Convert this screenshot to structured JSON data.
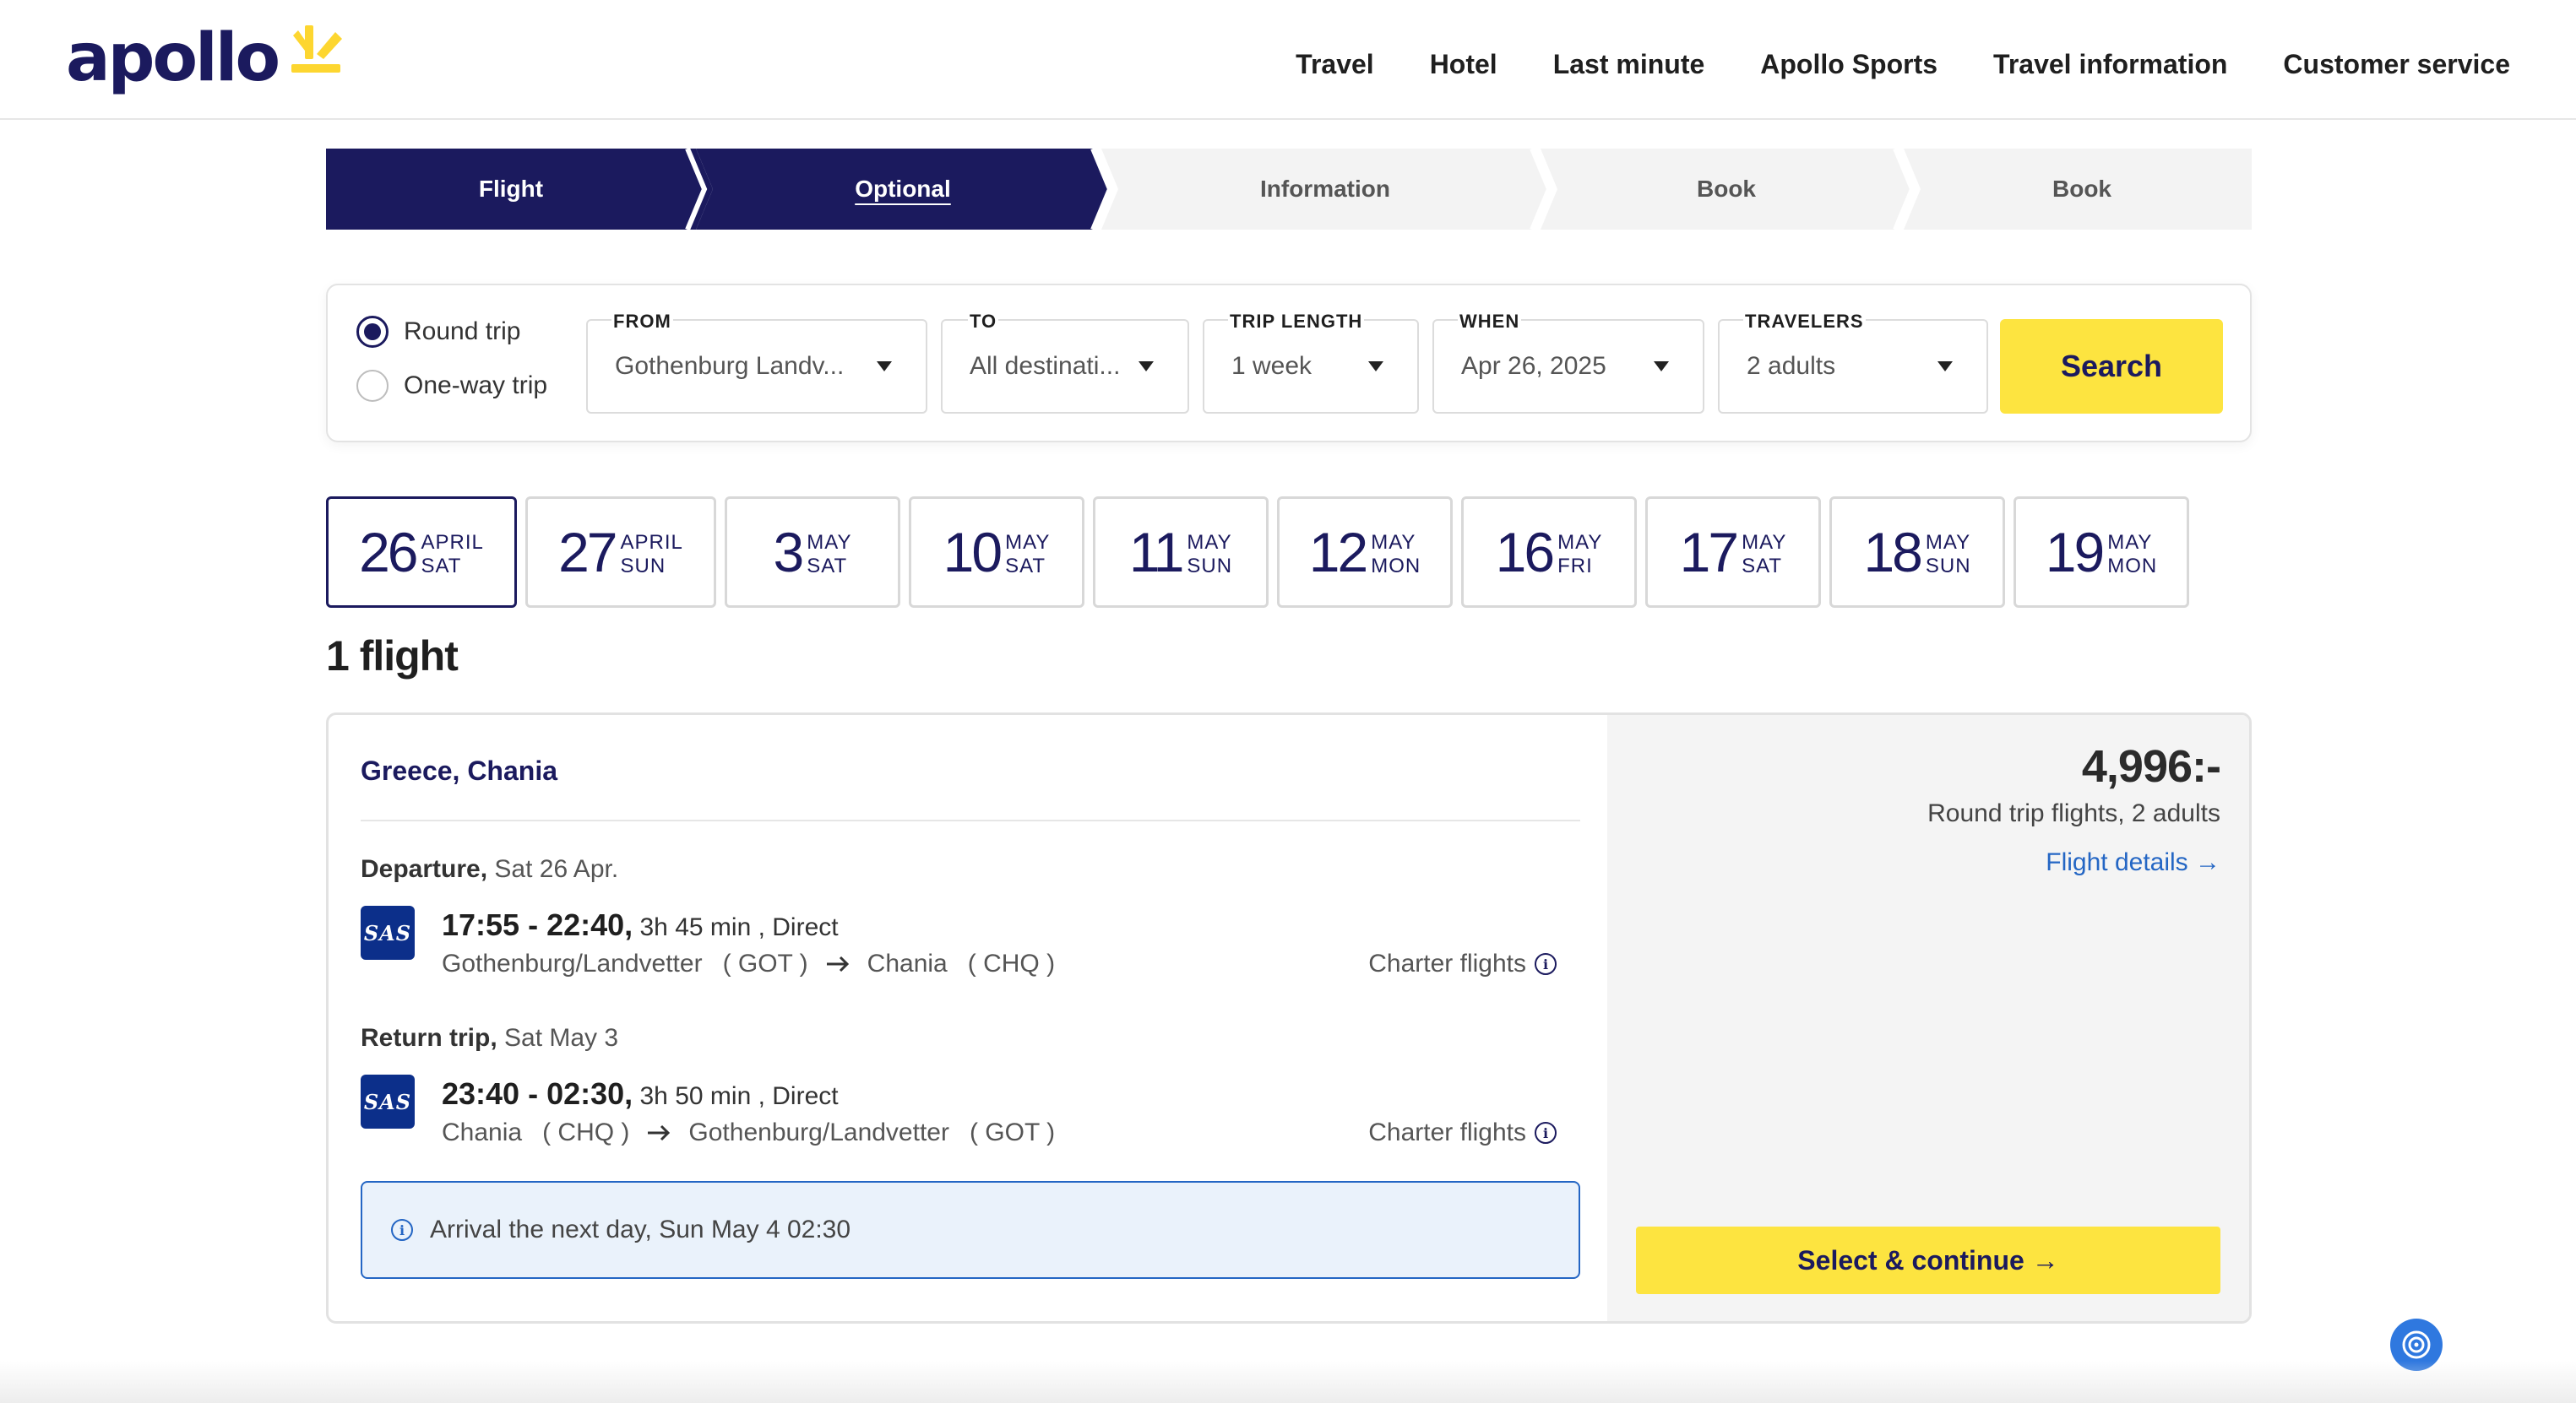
{
  "brand": {
    "name": "apollo",
    "accent": "#1b1a5e",
    "yellow": "#fde440",
    "link": "#2466c4"
  },
  "nav": [
    {
      "id": "travel",
      "label": "Travel"
    },
    {
      "id": "hotel",
      "label": "Hotel"
    },
    {
      "id": "last-minute",
      "label": "Last minute"
    },
    {
      "id": "apollo-sports",
      "label": "Apollo Sports"
    },
    {
      "id": "travel-information",
      "label": "Travel information"
    },
    {
      "id": "customer-service",
      "label": "Customer service"
    }
  ],
  "steps": [
    {
      "label": "Flight",
      "state": "done"
    },
    {
      "label": "Optional",
      "state": "current"
    },
    {
      "label": "Information",
      "state": "upcoming"
    },
    {
      "label": "Book",
      "state": "upcoming"
    },
    {
      "label": "Book",
      "state": "upcoming"
    }
  ],
  "search": {
    "trip_types": [
      {
        "label": "Round trip",
        "selected": true
      },
      {
        "label": "One-way trip",
        "selected": false
      }
    ],
    "from": {
      "label": "FROM",
      "value": "Gothenburg Landv..."
    },
    "to": {
      "label": "TO",
      "value": "All destinati..."
    },
    "trip_length": {
      "label": "TRIP LENGTH",
      "value": "1 week"
    },
    "when": {
      "label": "WHEN",
      "value": "Apr 26, 2025"
    },
    "travelers": {
      "label": "TRAVELERS",
      "value": "2 adults"
    },
    "button": "Search"
  },
  "dates": [
    {
      "day": "26",
      "month": "APRIL",
      "weekday": "SAT",
      "selected": true
    },
    {
      "day": "27",
      "month": "APRIL",
      "weekday": "SUN",
      "selected": false
    },
    {
      "day": "3",
      "month": "MAY",
      "weekday": "SAT",
      "selected": false
    },
    {
      "day": "10",
      "month": "MAY",
      "weekday": "SAT",
      "selected": false
    },
    {
      "day": "11",
      "month": "MAY",
      "weekday": "SUN",
      "selected": false
    },
    {
      "day": "12",
      "month": "MAY",
      "weekday": "MON",
      "selected": false
    },
    {
      "day": "16",
      "month": "MAY",
      "weekday": "FRI",
      "selected": false
    },
    {
      "day": "17",
      "month": "MAY",
      "weekday": "SAT",
      "selected": false
    },
    {
      "day": "18",
      "month": "MAY",
      "weekday": "SUN",
      "selected": false
    },
    {
      "day": "19",
      "month": "MAY",
      "weekday": "MON",
      "selected": false
    }
  ],
  "results": {
    "count_label": "1 flight",
    "flight": {
      "destination": "Greece, Chania",
      "departure": {
        "heading": "Departure,",
        "date": "Sat 26 Apr.",
        "airline": "SAS",
        "times": "17:55 - 22:40,",
        "duration": "3h 45 min , Direct",
        "from_city": "Gothenburg/Landvetter",
        "from_code": "( GOT )",
        "to_city": "Chania",
        "to_code": "( CHQ )",
        "type": "Charter flights"
      },
      "return": {
        "heading": "Return trip,",
        "date": "Sat May 3",
        "airline": "SAS",
        "times": "23:40 - 02:30,",
        "duration": "3h 50 min , Direct",
        "from_city": "Chania",
        "from_code": "( CHQ )",
        "to_city": "Gothenburg/Landvetter",
        "to_code": "( GOT )",
        "type": "Charter flights"
      },
      "notice": "Arrival the next day, Sun May 4 02:30",
      "price": "4,996:-",
      "price_note": "Round trip flights, 2 adults",
      "details_link": "Flight details →",
      "select_button": "Select & continue →"
    }
  }
}
